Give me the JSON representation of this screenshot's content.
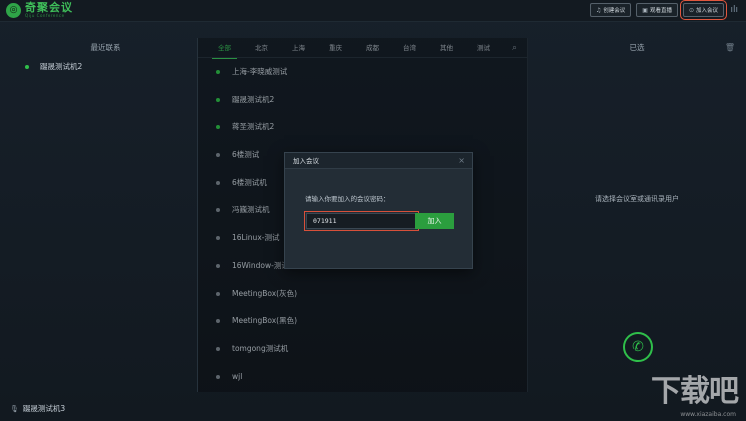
{
  "app": {
    "logo_mark": "◎",
    "logo_title": "奇聚会议",
    "logo_sub": "Qiju Conference"
  },
  "topbar": {
    "create_label": "创建会议",
    "live_label": "观看直播",
    "join_label": "加入会议",
    "audio_icon": "sound-wave-icon"
  },
  "left_panel": {
    "title": "最近联系",
    "items": [
      {
        "name": "蹑晟测试机2",
        "online": true
      }
    ]
  },
  "mid_panel": {
    "tabs": [
      "全部",
      "北京",
      "上海",
      "重庆",
      "成都",
      "台湾",
      "其他",
      "测试"
    ],
    "active_tab": 0,
    "contacts": [
      {
        "name": "上海-李晓威测试",
        "online": true
      },
      {
        "name": "蹑晟测试机2",
        "online": true
      },
      {
        "name": "蒋圣测试机2",
        "online": true
      },
      {
        "name": "6楼测试",
        "online": false
      },
      {
        "name": "6楼测试机",
        "online": false
      },
      {
        "name": "冯巍测试机",
        "online": false
      },
      {
        "name": "16Linux-测试",
        "online": false
      },
      {
        "name": "16Window-测试",
        "online": false
      },
      {
        "name": "MeetingBox(灰色)",
        "online": false
      },
      {
        "name": "MeetingBox(黑色)",
        "online": false
      },
      {
        "name": "tomgong测试机",
        "online": false
      },
      {
        "name": "wjl",
        "online": false
      }
    ]
  },
  "right_panel": {
    "title": "已选",
    "hint": "请选择会议室或通讯录用户"
  },
  "bottom": {
    "self_name": "蹑晟测试机3"
  },
  "dialog": {
    "title": "加入会议",
    "label": "请输入你要加入的会议密码：",
    "code_value": "071911",
    "join_button": "加入"
  },
  "watermark": {
    "text": "下载吧",
    "url": "www.xiazaiba.com"
  },
  "colors": {
    "accent_green": "#2fbf4a",
    "highlight_red": "#e2573e",
    "background": "#141b22"
  }
}
